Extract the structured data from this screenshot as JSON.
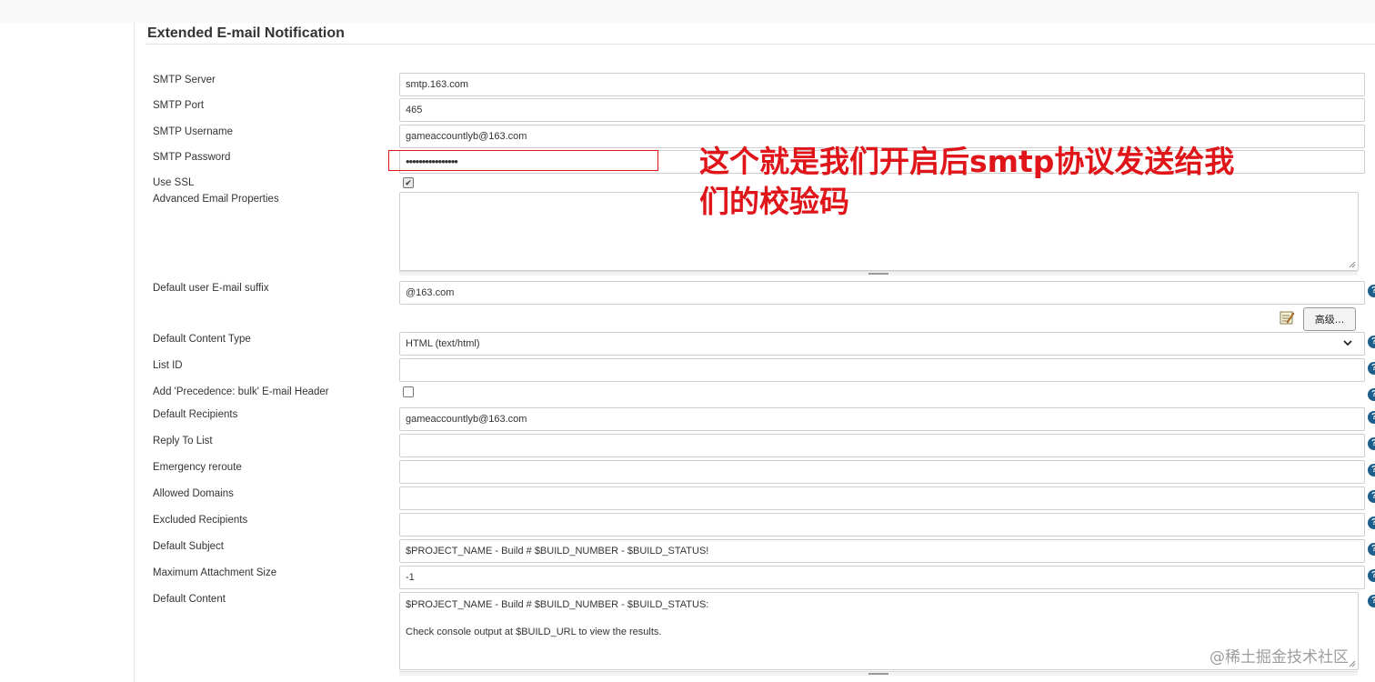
{
  "section": {
    "title": "Extended E-mail Notification"
  },
  "fields": {
    "smtp_server": {
      "label": "SMTP Server",
      "value": "smtp.163.com"
    },
    "smtp_port": {
      "label": "SMTP Port",
      "value": "465"
    },
    "smtp_username": {
      "label": "SMTP Username",
      "value": "gameaccountlyb@163.com"
    },
    "smtp_password": {
      "label": "SMTP Password",
      "value": "••••••••••••••••"
    },
    "use_ssl": {
      "label": "Use SSL",
      "checked": true
    },
    "advanced_props": {
      "label": "Advanced Email Properties",
      "value": ""
    },
    "email_suffix": {
      "label": "Default user E-mail suffix",
      "value": "@163.com"
    },
    "content_type": {
      "label": "Default Content Type",
      "value": "HTML (text/html)"
    },
    "list_id": {
      "label": "List ID",
      "value": ""
    },
    "precedence": {
      "label": "Add 'Precedence: bulk' E-mail Header",
      "checked": false
    },
    "recipients": {
      "label": "Default Recipients",
      "value": "gameaccountlyb@163.com"
    },
    "reply_to": {
      "label": "Reply To List",
      "value": ""
    },
    "emergency": {
      "label": "Emergency reroute",
      "value": ""
    },
    "allowed_domains": {
      "label": "Allowed Domains",
      "value": ""
    },
    "excluded": {
      "label": "Excluded Recipients",
      "value": ""
    },
    "subject": {
      "label": "Default Subject",
      "value": "$PROJECT_NAME - Build # $BUILD_NUMBER - $BUILD_STATUS!"
    },
    "max_attach": {
      "label": "Maximum Attachment Size",
      "value": "-1"
    },
    "content": {
      "label": "Default Content",
      "value": "$PROJECT_NAME - Build # $BUILD_NUMBER - $BUILD_STATUS:\n\nCheck console output at $BUILD_URL to view the results."
    }
  },
  "buttons": {
    "advanced": "高级..."
  },
  "help_glyph": "?",
  "annotation": {
    "text": "这个就是我们开启后smtp协议发送给我们的校验码",
    "color": "#e0151a"
  },
  "watermark": "@稀土掘金技术社区",
  "colors": {
    "help": "#1e5e8c",
    "annotation": "#e0151a"
  },
  "icons": [
    "notepad-icon",
    "help-icon",
    "chevron-down-icon",
    "checkmark-icon"
  ]
}
